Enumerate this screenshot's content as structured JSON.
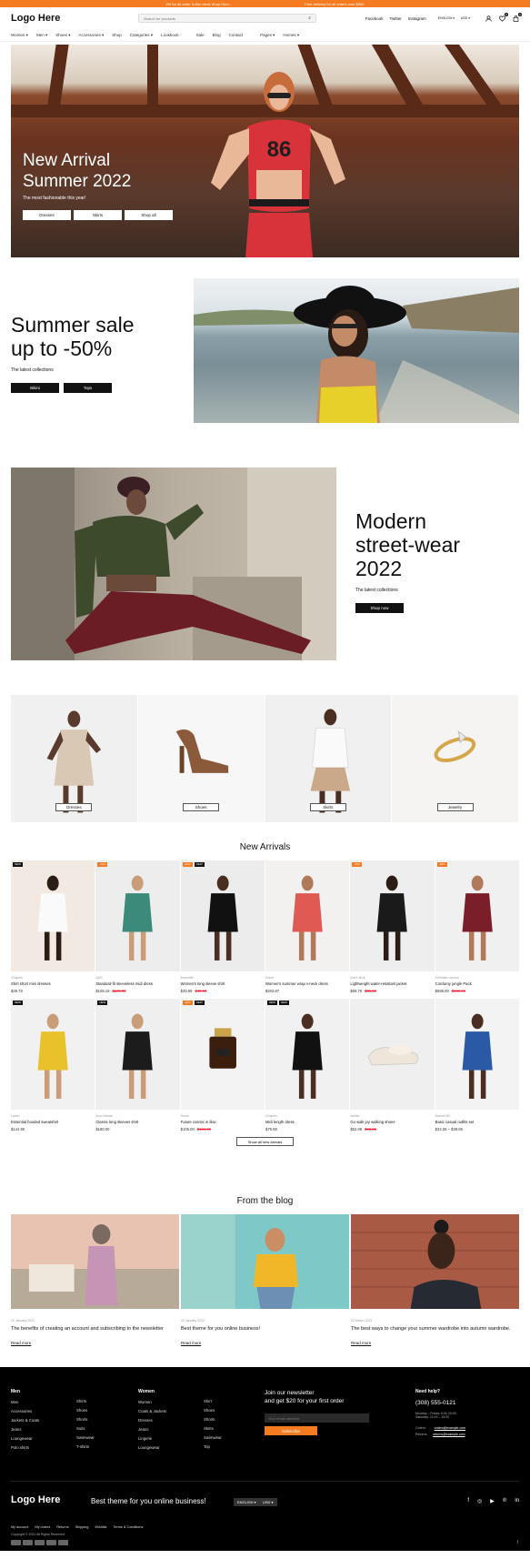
{
  "topbar": {
    "left": "4% for all order in this week Shop Here...",
    "right": "Free delivery for all orders over $300"
  },
  "header": {
    "logo": "Logo Here",
    "search_placeholder": "Search for products",
    "links": [
      "Facebook",
      "Twitter",
      "Instagram"
    ],
    "language": "ENGLISH ▾",
    "currency": "USD ▾",
    "wishlist_count": "0",
    "cart_count": "0"
  },
  "nav": [
    "Women ▾",
    "Men ▾",
    "Shoes ▾",
    "Accessories ▾",
    "Shop",
    "Categories ▾",
    "Lookbook",
    "Sale",
    "Blog",
    "Contact",
    "Pages ▾",
    "Homes ▾"
  ],
  "hero": {
    "title_line1": "New Arrival",
    "title_line2": "Summer 2022",
    "subtitle": "The most fashionable this year!",
    "buttons": [
      "Dresses",
      "Skirts",
      "Shop all"
    ],
    "shirt_number": "86"
  },
  "summer": {
    "title_line1": "Summer sale",
    "title_line2": "up to -50%",
    "subtitle": "The latest collections",
    "buttons": [
      "Bikini",
      "Tops"
    ]
  },
  "street": {
    "title_line1": "Modern",
    "title_line2": "street-wear",
    "title_line3": "2022",
    "subtitle": "The latest collections",
    "button": "Shop now"
  },
  "categories": [
    "Dresses",
    "Shoes",
    "Skirts",
    "Jewelry"
  ],
  "arrivals": {
    "title": "New Arrivals",
    "show_all": "Show all new arrivals",
    "products": [
      {
        "brand": "Chapels",
        "name": "Shirt short mini dresses",
        "price": "$49.79",
        "old": "",
        "tags": [
          "NEW"
        ]
      },
      {
        "brand": "Q&S",
        "name": "Standard-fit sleeveless midi dress",
        "price": "$106.18",
        "old": "$139.89",
        "tags": [
          "-20%"
        ]
      },
      {
        "brand": "Mochette",
        "name": "Women's long sleeve shirt",
        "price": "$39.99",
        "old": "$49.99",
        "tags": [
          "-20%",
          "NEW"
        ]
      },
      {
        "brand": "Dotch",
        "name": "Women's summer wrap v-neck dress",
        "price": "$202.87",
        "old": "",
        "tags": []
      },
      {
        "brand": "Zoe's Nick",
        "name": "Lightweight water-resistant jacket",
        "price": "$69.79",
        "old": "$86.99",
        "tags": [
          "-20%"
        ]
      },
      {
        "brand": "Christian Lacroix",
        "name": "Corduroy jungle Pack",
        "price": "$698.00",
        "old": "$839.00",
        "tags": [
          "-20%"
        ]
      },
      {
        "brand": "Lamel",
        "name": "Essential hooded sweatshirt",
        "price": "$144.90",
        "old": "",
        "tags": [
          "NEW"
        ]
      },
      {
        "brand": "Arco Nature",
        "name": "Classic long sleeves shirt",
        "price": "$180.00",
        "old": "",
        "tags": [
          "NEW"
        ]
      },
      {
        "brand": "Shubi",
        "name": "Future cosmic in lilac",
        "price": "$105.00",
        "old": "$134.90",
        "tags": [
          "-20%",
          "NEW"
        ]
      },
      {
        "brand": "Chapels",
        "name": "Midi length dress",
        "price": "$79.99",
        "old": "",
        "tags": [
          "NEW",
          "NEW"
        ]
      },
      {
        "brand": "Aether",
        "name": "Go walk joy walking shoes",
        "price": "$52.08",
        "old": "$68.95",
        "tags": []
      },
      {
        "brand": "Darkier 85",
        "name": "Basic casual outfits set",
        "price": "$32.08 – $39.95",
        "old": "",
        "tags": []
      }
    ]
  },
  "blog": {
    "title": "From the blog",
    "read_more": "Read more",
    "posts": [
      {
        "date": "12 January 2022",
        "title": "The benefits of creating an account and subscribing to the newsletter"
      },
      {
        "date": "22 January 2022",
        "title": "Best theme for you online business!"
      },
      {
        "date": "02 March 2022",
        "title": "The best ways to change your summer wardrobe into autumn wardrobe."
      }
    ]
  },
  "footer": {
    "men_title": "Men",
    "men_col1": [
      "Men",
      "Accessories",
      "Jackets & Coats",
      "Jeans",
      "Loungewear",
      "Polo shirts"
    ],
    "men_col2": [
      "Shirts",
      "Shoes",
      "Shorts",
      "Suits",
      "Swimwear",
      "T-shirts"
    ],
    "women_title": "Women",
    "women_col1": [
      "Women",
      "Coats & Jackets",
      "Dresses",
      "Jeans",
      "Lingerie",
      "Loungewear"
    ],
    "women_col2": [
      "Shirt",
      "Shoes",
      "Shorts",
      "Skirts",
      "Swimwear",
      "Top"
    ],
    "news_line1": "Join our newsletter",
    "news_line2": "and get $20 for your first order",
    "email_placeholder": "Your email address",
    "subscribe": "Subscribe",
    "help_title": "Need help?",
    "phone": "(308) 555-0121",
    "hours1": "Monday – Friday: 9:00-20:00",
    "hours2": "Saturday: 11:00 – 15:00",
    "orders_label": "Orders:",
    "orders_email": "orders@example.com",
    "returns_label": "Returns:",
    "returns_email": "returns@example.com",
    "logo": "Logo Here",
    "tagline": "Best theme for you online business!",
    "language": "ENGLISH ▾",
    "currency": "USD ▾",
    "links": [
      "My account",
      "My orders",
      "Returns",
      "Shipping",
      "Wishlist",
      "Terms & Conditions"
    ],
    "copyright": "Copyright © 2021 All Rights Reserved",
    "back_to_top": "↑"
  },
  "colors": {
    "accent": "#f47b20",
    "dark": "#000000"
  }
}
